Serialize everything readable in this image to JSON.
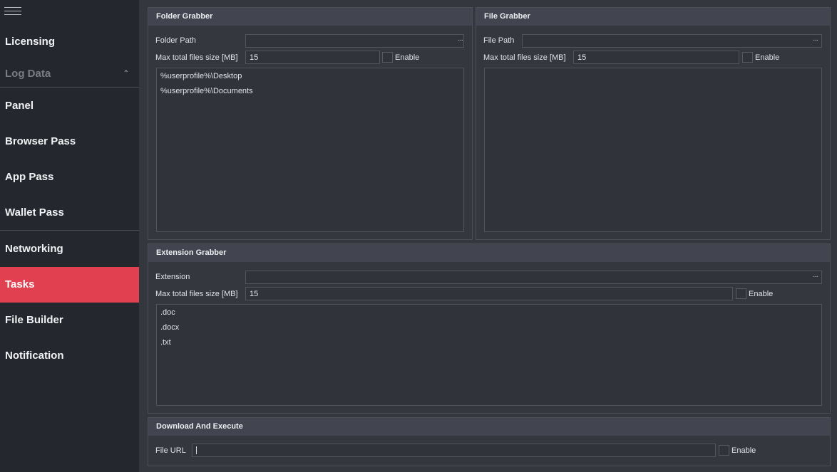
{
  "sidebar": {
    "items": [
      {
        "label": "Licensing"
      },
      {
        "label": "Log Data",
        "expanded": true
      },
      {
        "label": "Panel"
      },
      {
        "label": "Browser Pass"
      },
      {
        "label": "App Pass"
      },
      {
        "label": "Wallet Pass"
      },
      {
        "label": "Networking"
      },
      {
        "label": "Tasks",
        "active": true
      },
      {
        "label": "File Builder"
      },
      {
        "label": "Notification"
      }
    ],
    "chevron": "⌃",
    "menu_icon": "hamburger-icon"
  },
  "folder_grabber": {
    "title": "Folder Grabber",
    "path_label": "Folder Path",
    "path_value": "",
    "browse_label": "···",
    "size_label": "Max total files size [MB]",
    "size_value": "15",
    "enable_label": "Enable",
    "enabled": false,
    "items": [
      "%userprofile%\\Desktop",
      "%userprofile%\\Documents"
    ]
  },
  "file_grabber": {
    "title": "File Grabber",
    "path_label": "File Path",
    "path_value": "",
    "browse_label": "···",
    "size_label": "Max total files size [MB]",
    "size_value": "15",
    "enable_label": "Enable",
    "enabled": false,
    "items": []
  },
  "extension_grabber": {
    "title": "Extension Grabber",
    "ext_label": "Extension",
    "ext_value": "",
    "browse_label": "···",
    "size_label": "Max total files size [MB]",
    "size_value": "15",
    "enable_label": "Enable",
    "enabled": false,
    "items": [
      ".doc",
      ".docx",
      ".txt"
    ]
  },
  "download_execute": {
    "title": "Download And Execute",
    "url_label": "File URL",
    "url_value": "",
    "enable_label": "Enable",
    "enabled": false
  },
  "colors": {
    "sidebar_bg": "#25272e",
    "content_bg": "#34373e",
    "panel_header": "#424550",
    "accent_active": "#e0404f",
    "field_bg": "#30333a",
    "border": "#4c4f57"
  }
}
